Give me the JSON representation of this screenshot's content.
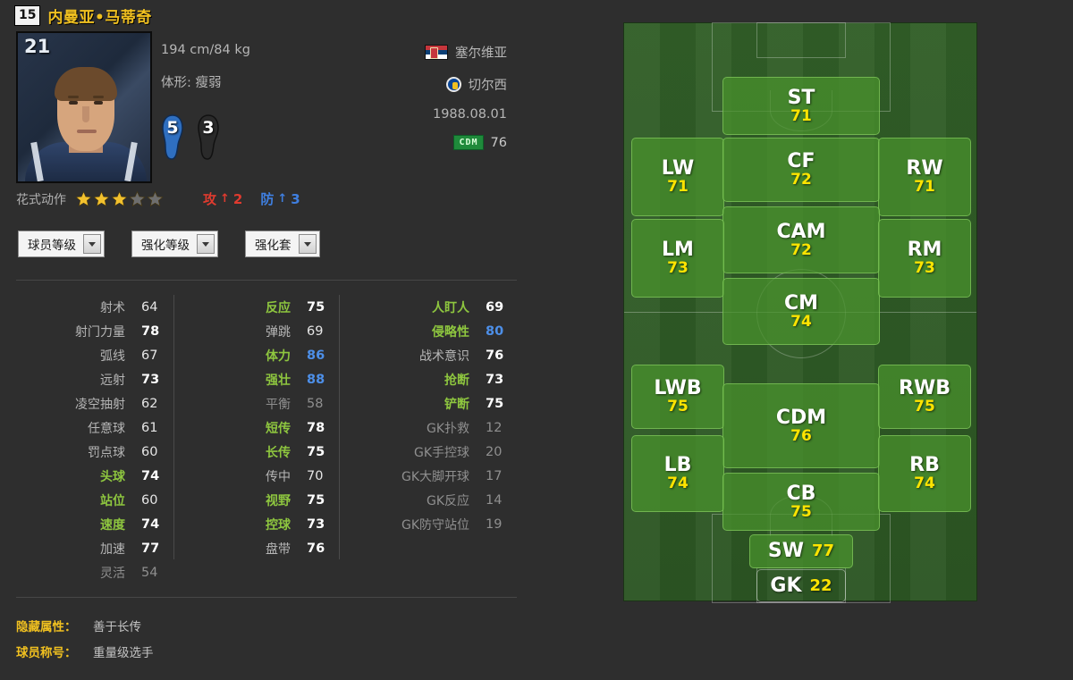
{
  "player": {
    "skill_moves_badge": "15",
    "name": "内曼亚•马蒂奇",
    "shirt_number": "21",
    "physique": "194 cm/84 kg",
    "body_type_label": "体形: 瘦弱",
    "strong_foot_rating": "5",
    "weak_foot_rating": "3",
    "nationality": "塞尔维亚",
    "club": "切尔西",
    "birthdate": "1988.08.01",
    "main_position": "CDM",
    "main_position_rating": "76"
  },
  "skill_row": {
    "label": "花式动作",
    "stars_filled": 3,
    "stars_total": 5,
    "attack_label": "攻",
    "attack_value": "2",
    "defense_label": "防",
    "defense_value": "3",
    "arrow": "↑"
  },
  "selects": [
    {
      "label": "球员等级"
    },
    {
      "label": "强化等级"
    },
    {
      "label": "强化套"
    }
  ],
  "stats": {
    "col1": [
      {
        "name": "射术",
        "value": "64",
        "name_tier": "grey",
        "value_tier": "mid"
      },
      {
        "name": "射门力量",
        "value": "78",
        "name_tier": "grey",
        "value_tier": "hi"
      },
      {
        "name": "弧线",
        "value": "67",
        "name_tier": "grey",
        "value_tier": "mid"
      },
      {
        "name": "远射",
        "value": "73",
        "name_tier": "grey",
        "value_tier": "hi"
      },
      {
        "name": "凌空抽射",
        "value": "62",
        "name_tier": "grey",
        "value_tier": "mid"
      },
      {
        "name": "任意球",
        "value": "61",
        "name_tier": "grey",
        "value_tier": "mid"
      },
      {
        "name": "罚点球",
        "value": "60",
        "name_tier": "grey",
        "value_tier": "mid"
      },
      {
        "name": "头球",
        "value": "74",
        "name_tier": "green",
        "value_tier": "hi"
      },
      {
        "name": "站位",
        "value": "60",
        "name_tier": "green",
        "value_tier": "mid"
      },
      {
        "name": "速度",
        "value": "74",
        "name_tier": "green",
        "value_tier": "hi"
      },
      {
        "name": "加速",
        "value": "77",
        "name_tier": "grey",
        "value_tier": "hi"
      },
      {
        "name": "灵活",
        "value": "54",
        "name_tier": "dim",
        "value_tier": "lo"
      }
    ],
    "col2": [
      {
        "name": "反应",
        "value": "75",
        "name_tier": "green",
        "value_tier": "hi"
      },
      {
        "name": "弹跳",
        "value": "69",
        "name_tier": "grey",
        "value_tier": "mid"
      },
      {
        "name": "体力",
        "value": "86",
        "name_tier": "green",
        "value_tier": "blue"
      },
      {
        "name": "强壮",
        "value": "88",
        "name_tier": "green",
        "value_tier": "blue"
      },
      {
        "name": "平衡",
        "value": "58",
        "name_tier": "dim",
        "value_tier": "lo"
      },
      {
        "name": "短传",
        "value": "78",
        "name_tier": "green",
        "value_tier": "hi"
      },
      {
        "name": "长传",
        "value": "75",
        "name_tier": "green",
        "value_tier": "hi"
      },
      {
        "name": "传中",
        "value": "70",
        "name_tier": "grey",
        "value_tier": "mid"
      },
      {
        "name": "视野",
        "value": "75",
        "name_tier": "green",
        "value_tier": "hi"
      },
      {
        "name": "控球",
        "value": "73",
        "name_tier": "green",
        "value_tier": "hi"
      },
      {
        "name": "盘带",
        "value": "76",
        "name_tier": "grey",
        "value_tier": "hi"
      }
    ],
    "col3": [
      {
        "name": "人盯人",
        "value": "69",
        "name_tier": "green",
        "value_tier": "hi"
      },
      {
        "name": "侵略性",
        "value": "80",
        "name_tier": "green",
        "value_tier": "blue"
      },
      {
        "name": "战术意识",
        "value": "76",
        "name_tier": "grey",
        "value_tier": "hi"
      },
      {
        "name": "抢断",
        "value": "73",
        "name_tier": "green",
        "value_tier": "hi"
      },
      {
        "name": "铲断",
        "value": "75",
        "name_tier": "green",
        "value_tier": "hi"
      },
      {
        "name": "GK扑救",
        "value": "12",
        "name_tier": "dim",
        "value_tier": "lo"
      },
      {
        "name": "GK手控球",
        "value": "20",
        "name_tier": "dim",
        "value_tier": "lo"
      },
      {
        "name": "GK大脚开球",
        "value": "17",
        "name_tier": "dim",
        "value_tier": "lo"
      },
      {
        "name": "GK反应",
        "value": "14",
        "name_tier": "dim",
        "value_tier": "lo"
      },
      {
        "name": "GK防守站位",
        "value": "19",
        "name_tier": "dim",
        "value_tier": "lo"
      }
    ]
  },
  "footer": [
    {
      "key": "隐藏属性：",
      "value": "善于长传"
    },
    {
      "key": "球员称号：",
      "value": "重量级选手"
    }
  ],
  "pitch": {
    "positions": [
      {
        "pos": "ST",
        "rating": "71"
      },
      {
        "pos": "LW",
        "rating": "71"
      },
      {
        "pos": "CF",
        "rating": "72"
      },
      {
        "pos": "RW",
        "rating": "71"
      },
      {
        "pos": "CAM",
        "rating": "72"
      },
      {
        "pos": "LM",
        "rating": "73"
      },
      {
        "pos": "CM",
        "rating": "74"
      },
      {
        "pos": "RM",
        "rating": "73"
      },
      {
        "pos": "LWB",
        "rating": "75"
      },
      {
        "pos": "CDM",
        "rating": "76"
      },
      {
        "pos": "RWB",
        "rating": "75"
      },
      {
        "pos": "LB",
        "rating": "74"
      },
      {
        "pos": "CB",
        "rating": "75"
      },
      {
        "pos": "RB",
        "rating": "74"
      },
      {
        "pos": "SW",
        "rating": "77"
      },
      {
        "pos": "GK",
        "rating": "22"
      }
    ]
  },
  "colors": {
    "background": "#2e2e2e",
    "name_accent": "#f0c020",
    "stat_green": "#8ec63f",
    "stat_blue": "#4d8fe8",
    "rating_yellow": "#ffe400",
    "pitch_green": "#315e27",
    "cell_green": "#4a932d",
    "attack_red": "#e03b2f",
    "defense_blue": "#3f7fe0"
  }
}
